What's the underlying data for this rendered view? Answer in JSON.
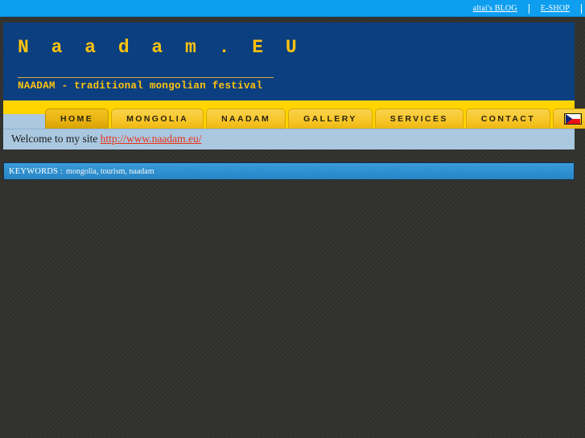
{
  "topbar": {
    "links": [
      {
        "label": "altai's BLOG",
        "name": "topbar-link-blog"
      },
      {
        "label": "E-SHOP",
        "name": "topbar-link-eshop"
      }
    ]
  },
  "header": {
    "logo": "N a a d a m . E U",
    "tagline": "NAADAM - traditional mongolian festival"
  },
  "nav": {
    "items": [
      {
        "label": "HOME",
        "active": true
      },
      {
        "label": "MONGOLIA",
        "active": false
      },
      {
        "label": "NAADAM",
        "active": false
      },
      {
        "label": "GALLERY",
        "active": false
      },
      {
        "label": "SERVICES",
        "active": false
      },
      {
        "label": "CONTACT",
        "active": false
      }
    ],
    "language_flags": [
      {
        "icon": "czech-flag-icon",
        "selected": false
      },
      {
        "icon": "usa-flag-icon",
        "selected": true
      }
    ]
  },
  "welcome": {
    "text": "Welcome to my site ",
    "link": "http://www.naadam.eu/"
  },
  "keywords": {
    "label": "KEYWORDS :",
    "values": "mongolia, tourism, naadam"
  },
  "colors": {
    "topbar_blue": "#0e9ef0",
    "header_blue": "#0b3f80",
    "logo_yellow": "#ffc20e",
    "nav_yellow": "#ffd400",
    "welcome_blue": "#aac8e0",
    "keywords_blue": "#2f8fcf",
    "link_red": "#e8321a",
    "page_bg": "#32332f"
  }
}
